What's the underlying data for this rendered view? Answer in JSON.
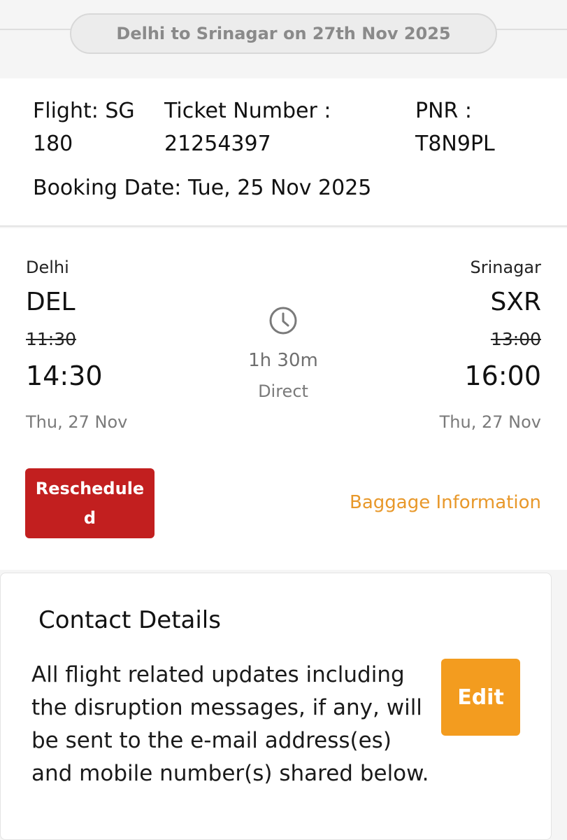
{
  "route": {
    "title": "Delhi to Srinagar on 27th Nov 2025"
  },
  "booking": {
    "flight": "Flight: SG 180",
    "ticket": "Ticket Number : 21254397",
    "pnr": "PNR : T8N9PL",
    "booking_date": "Booking Date: Tue, 25 Nov 2025"
  },
  "journey": {
    "origin": {
      "city": "Delhi",
      "code": "DEL",
      "old_time": "11:30",
      "new_time": "14:30",
      "date": "Thu, 27 Nov"
    },
    "destination": {
      "city": "Srinagar",
      "code": "SXR",
      "old_time": "13:00",
      "new_time": "16:00",
      "date": "Thu, 27 Nov"
    },
    "duration": "1h 30m",
    "stops": "Direct",
    "status": "Rescheduled",
    "baggage_link": "Baggage Information",
    "icon": "clock-icon"
  },
  "contact": {
    "title": "Contact Details",
    "description": "All flight related updates including the disruption messages, if any, will be sent to the e-mail address(es) and mobile number(s) shared below.",
    "edit_label": "Edit"
  },
  "colors": {
    "status_red": "#c21f1f",
    "accent_orange": "#f39c1f",
    "link_orange": "#e8982a"
  }
}
